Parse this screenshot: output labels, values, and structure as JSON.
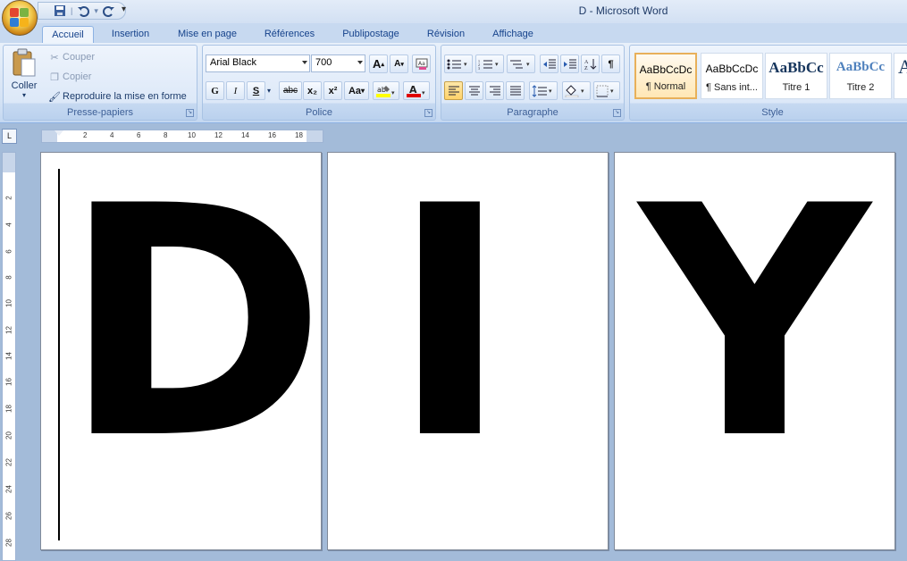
{
  "window": {
    "title": "D - Microsoft Word"
  },
  "quick_access": {
    "save_icon": "save-icon",
    "undo_icon": "undo-icon",
    "redo_icon": "redo-icon"
  },
  "tabs": [
    "Accueil",
    "Insertion",
    "Mise en page",
    "Références",
    "Publipostage",
    "Révision",
    "Affichage"
  ],
  "ribbon": {
    "clipboard": {
      "label": "Presse-papiers",
      "paste": "Coller",
      "cut": "Couper",
      "copy": "Copier",
      "format_painter": "Reproduire la mise en forme"
    },
    "font": {
      "label": "Police",
      "font_name": "Arial Black",
      "font_size": "700",
      "bold": "G",
      "italic": "I",
      "underline": "S",
      "strike": "abc",
      "subscript": "x₂",
      "superscript": "x²",
      "change_case": "Aa",
      "grow": "A",
      "shrink": "A"
    },
    "paragraph": {
      "label": "Paragraphe"
    },
    "styles": {
      "label": "Style",
      "items": [
        {
          "sample": "AaBbCcDc",
          "name": "¶ Normal"
        },
        {
          "sample": "AaBbCcDc",
          "name": "¶ Sans int..."
        },
        {
          "sample": "AaBbCc",
          "name": "Titre 1"
        },
        {
          "sample": "AaBbCc",
          "name": "Titre 2"
        }
      ]
    }
  },
  "ruler": {
    "h_ticks": [
      "2",
      "4",
      "6",
      "8",
      "10",
      "12",
      "14",
      "16",
      "18"
    ],
    "v_ticks": [
      "2",
      "4",
      "6",
      "8",
      "10",
      "12",
      "14",
      "16",
      "18",
      "20",
      "22",
      "24",
      "26",
      "28"
    ]
  },
  "document": {
    "pages": [
      {
        "letter": "D"
      },
      {
        "letter": "I"
      },
      {
        "letter": "Y"
      }
    ]
  },
  "colors": {
    "ribbon_blue": "#d5e3f5",
    "highlight_yellow": "#ffff00",
    "font_color_red": "#e00000"
  }
}
